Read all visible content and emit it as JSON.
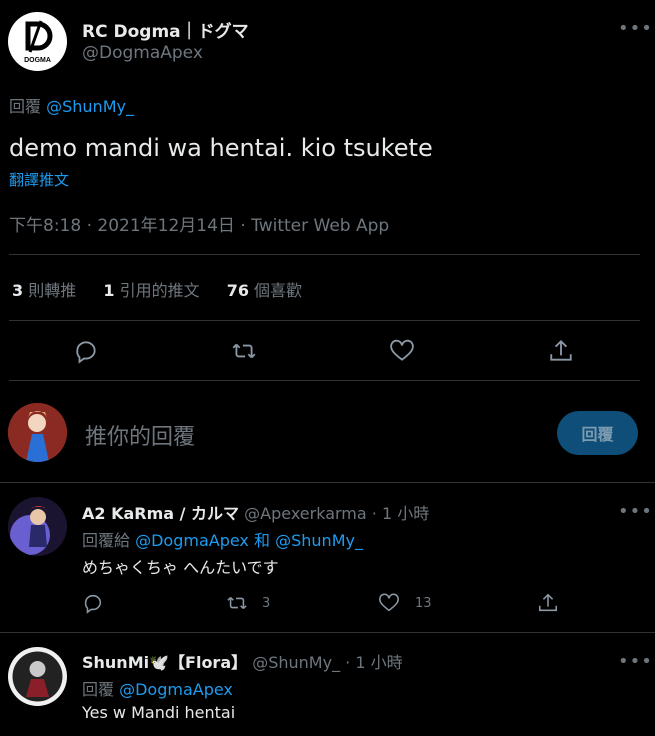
{
  "tweet": {
    "author_name": "RC Dogma｜ドグマ",
    "author_handle": "@DogmaApex",
    "avatar_text": "DOGMA",
    "reply_prefix": "回覆",
    "reply_to": "@ShunMy_",
    "text": "demo mandi wa hentai. kio tsukete",
    "translate": "翻譯推文",
    "meta": "下午8:18 · 2021年12月14日 · Twitter Web App",
    "stats": {
      "retweets_num": "3",
      "retweets_label": "則轉推",
      "quotes_num": "1",
      "quotes_label": "引用的推文",
      "likes_num": "76",
      "likes_label": "個喜歡"
    }
  },
  "composer": {
    "placeholder": "推你的回覆",
    "button": "回覆"
  },
  "replies": [
    {
      "author_name": "A2 KaRma / カルマ",
      "author_handle": "@Apexerkarma",
      "time": "· 1 小時",
      "reply_prefix": "回覆給",
      "reply_to_1": "@DogmaApex",
      "conj": "和",
      "reply_to_2": "@ShunMy_",
      "text": "めちゃくちゃ へんたいです",
      "retweets": "3",
      "likes": "13"
    },
    {
      "author_name": "ShunMi🕊️【Flora】",
      "author_handle": "@ShunMy_",
      "time": "· 1 小時",
      "reply_prefix": "回覆",
      "reply_to_1": "@DogmaApex",
      "text": "Yes w Mandi hentai"
    }
  ],
  "icons": [
    "reply-icon",
    "retweet-icon",
    "like-icon",
    "share-icon",
    "more-icon"
  ],
  "colors": {
    "accent": "#1d9bf0",
    "background": "#000000",
    "muted": "#6e767d",
    "divider": "#2f3336"
  }
}
